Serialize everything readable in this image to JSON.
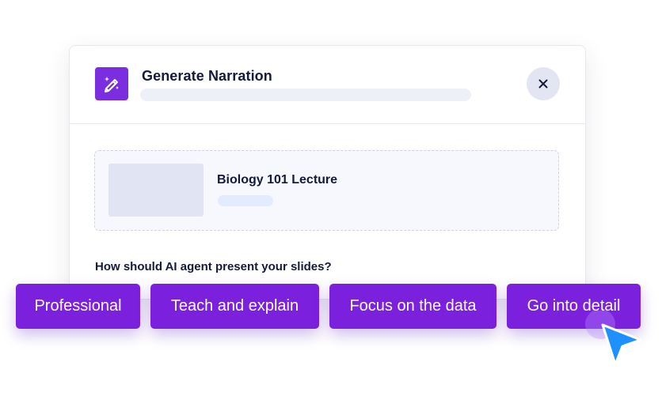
{
  "modal": {
    "title": "Generate Narration",
    "icon": "magic-wand-icon",
    "close_icon": "close-icon",
    "close_symbol": "✕"
  },
  "slide": {
    "name": "Biology 101 Lecture"
  },
  "question": "How should AI agent present your slides?",
  "options": [
    {
      "label": "Professional"
    },
    {
      "label": "Teach and explain"
    },
    {
      "label": "Focus on the data"
    },
    {
      "label": "Go into detail"
    }
  ],
  "colors": {
    "accent": "#7b21dd",
    "cursor": "#1e90ff",
    "text": "#141a3a"
  }
}
